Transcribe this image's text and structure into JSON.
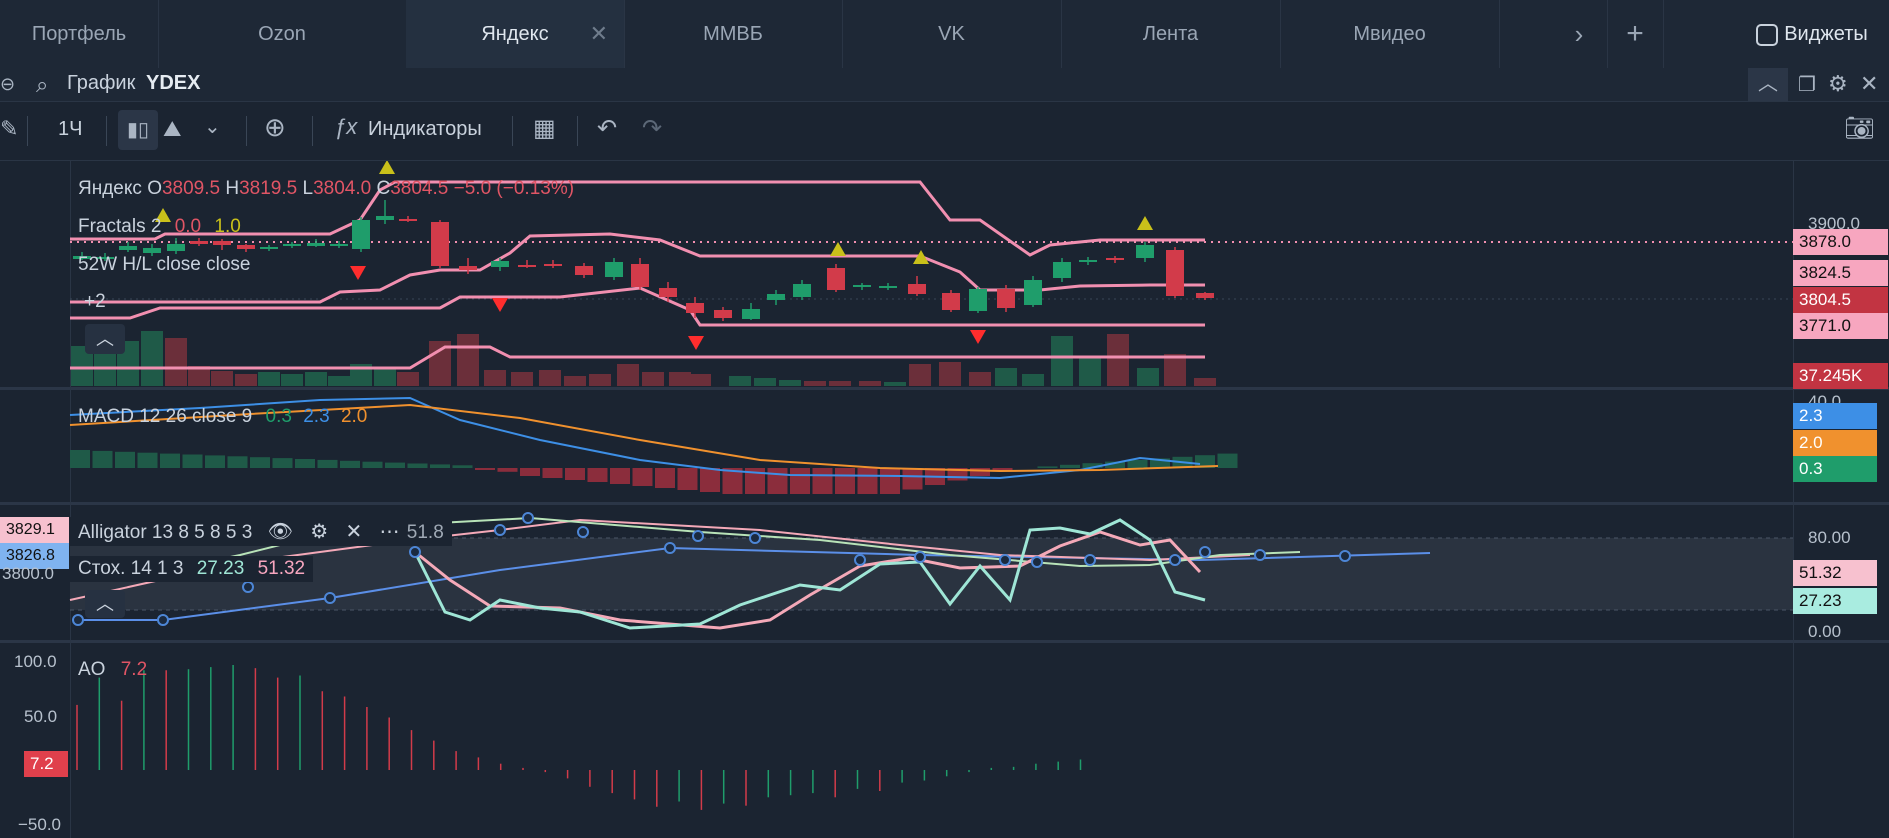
{
  "tabs": [
    {
      "label": "Портфель"
    },
    {
      "label": "Ozon"
    },
    {
      "label": "Яндекс"
    },
    {
      "label": "ММВБ"
    },
    {
      "label": "VK"
    },
    {
      "label": "Лента"
    },
    {
      "label": "Мвидео"
    }
  ],
  "tabs_extra": {
    "widgets": "Виджеты"
  },
  "search": {
    "label": "График",
    "ticker": "YDEX"
  },
  "toolbar": {
    "interval": "1Ч",
    "indicators": "Индикаторы"
  },
  "main_pane": {
    "ohlc_name": "Яндекс",
    "o_label": "O",
    "o": "3809.5",
    "h_label": "H",
    "h": "3819.5",
    "l_label": "L",
    "l": "3804.0",
    "c_label": "C",
    "c": "3804.5",
    "change": "−5.0 (−0.13%)",
    "fractals_label": "Fractals 2",
    "fractals_v1": "0.0",
    "fractals_v2": "1.0",
    "hl_label": "52W H/L close close",
    "more": "+2"
  },
  "price_axis": {
    "tick_3900": "3900.0",
    "tag_3878": "3878.0",
    "tag_3824": "3824.5",
    "tag_last": "3804.5",
    "tag_3771": "3771.0",
    "tag_volume": "37.245K"
  },
  "macd_pane": {
    "label": "MACD 12 26 close 9",
    "v1": "0.3",
    "v2": "2.3",
    "v3": "2.0",
    "axis_top": "40.0",
    "tag_blue": "2.3",
    "tag_orange": "2.0",
    "tag_green": "0.3"
  },
  "stoch_pane": {
    "alligator_label": "Alligator 13 8 5 8 5 3",
    "alligator_val": "51.8",
    "stoch_label": "Стох. 14 1 3",
    "k": "27.23",
    "d": "51.32",
    "left_tag_1": "3829.1",
    "left_tag_2": "3826.8",
    "left_axis": "3800.0",
    "axis_80": "80.00",
    "axis_0": "0.00",
    "tag_d": "51.32",
    "tag_k": "27.23"
  },
  "ao_pane": {
    "label": "AO",
    "value": "7.2",
    "axis_100": "100.0",
    "axis_50": "50.0",
    "tag": "7.2",
    "axis_m50": "−50.0"
  },
  "colors": {
    "up": "#1f9d6b",
    "down": "#d23b4a",
    "pink": "#f18fb0",
    "blue": "#3d8fe6",
    "orange": "#f0912e",
    "mint": "#9fe6d6",
    "yellow": "#c9c01a",
    "red_marker": "#ff2d2d"
  }
}
